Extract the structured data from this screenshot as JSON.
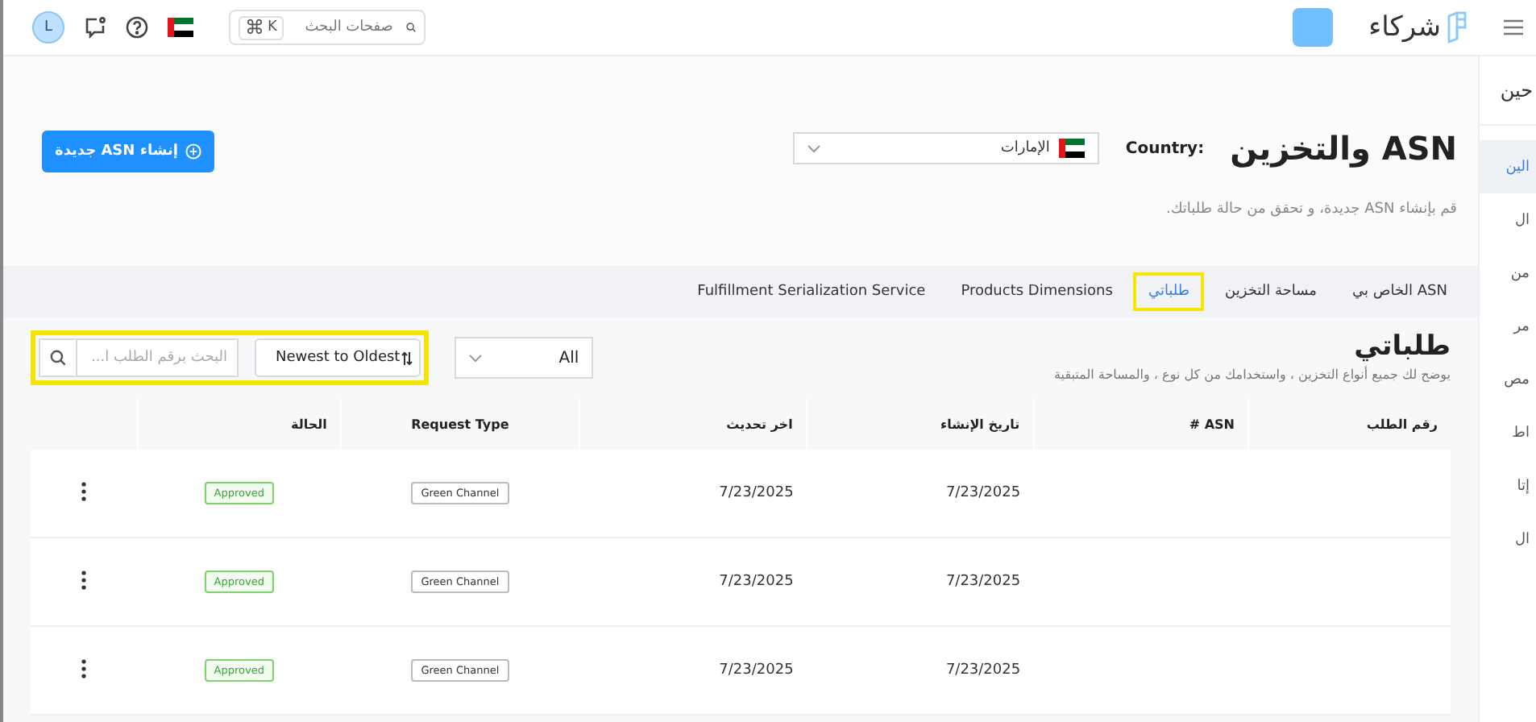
{
  "topbar": {
    "avatar": "L",
    "search": {
      "placeholder": "صفحات البحث",
      "shortcut_symbol": "⌘",
      "shortcut_key": "K"
    },
    "logo": "شركاء"
  },
  "header": {
    "title": "ASN والتخزين",
    "country_label": "Country:",
    "country_value": "الإمارات",
    "subtitle": "قم بإنشاء ASN جديدة، و تحقق من حالة طلباتك.",
    "create_button": "إنشاء ASN جديدة"
  },
  "tabs": [
    {
      "label": "ASN الخاص بي",
      "selected": false,
      "highlighted": false
    },
    {
      "label": "مساحة التخزين",
      "selected": false,
      "highlighted": false
    },
    {
      "label": "طلباتي",
      "selected": true,
      "highlighted": true
    },
    {
      "label": "Products Dimensions",
      "selected": false,
      "highlighted": false
    },
    {
      "label": "Fulfillment Serialization Service",
      "selected": false,
      "highlighted": false
    }
  ],
  "orders": {
    "title": "طلباتي",
    "description": "يوضح لك جميع أنواع التخزين ، واستخدامك من كل نوع ، والمساحة المتبقية",
    "filter": "All",
    "sort": "Newest to Oldest",
    "search_placeholder": "البحث برقم الطلب ا...",
    "columns": [
      "رقم الطلب",
      "ASN #",
      "تاريخ الإنشاء",
      "اخر تحديث",
      "Request Type",
      "الحالة"
    ],
    "rows": [
      {
        "created": "7/23/2025",
        "updated": "7/23/2025",
        "request_type": "Green Channel",
        "status": "Approved"
      },
      {
        "created": "7/23/2025",
        "updated": "7/23/2025",
        "request_type": "Green Channel",
        "status": "Approved"
      },
      {
        "created": "7/23/2025",
        "updated": "7/23/2025",
        "request_type": "Green Channel",
        "status": "Approved"
      }
    ]
  },
  "side_panel": {
    "title": "حين",
    "items": [
      {
        "label": "الين",
        "selected": true
      },
      {
        "label": "ال",
        "selected": false
      },
      {
        "label": "من",
        "selected": false
      },
      {
        "label": "مر",
        "selected": false
      },
      {
        "label": "مص",
        "selected": false
      },
      {
        "label": "اط",
        "selected": false
      },
      {
        "label": "إتا",
        "selected": false
      },
      {
        "label": "ال",
        "selected": false
      }
    ]
  }
}
